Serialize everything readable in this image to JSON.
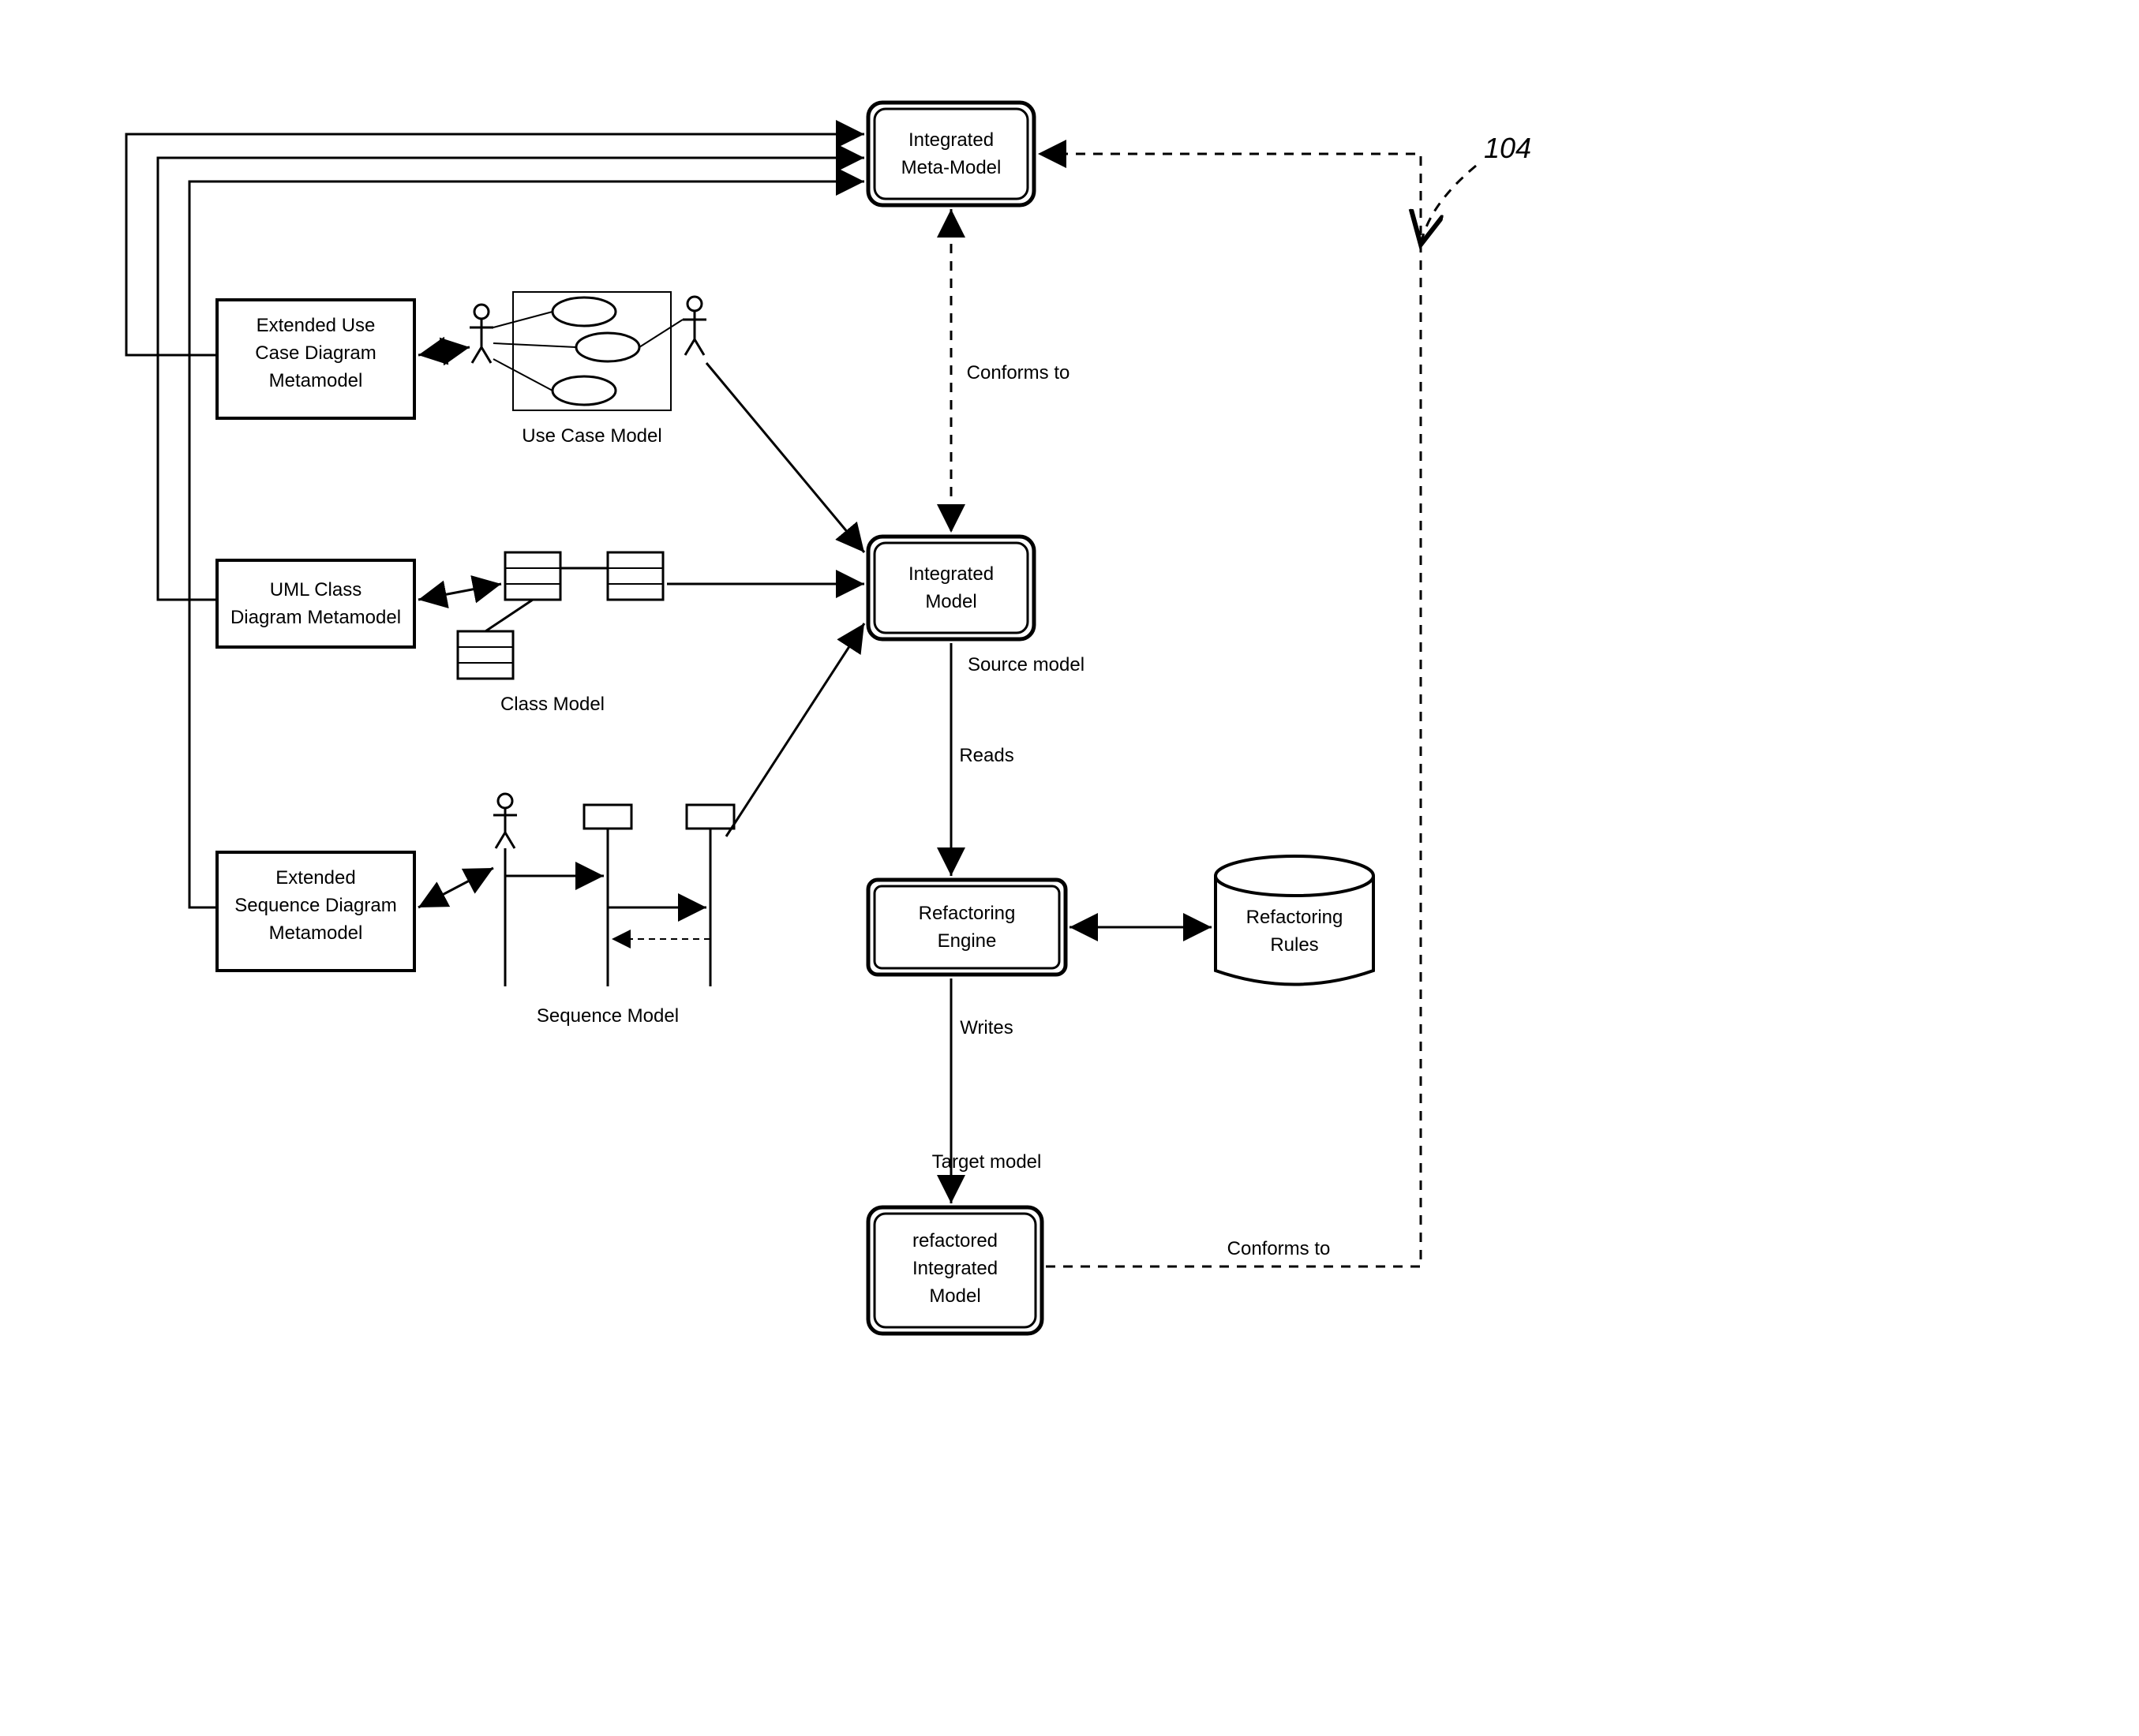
{
  "ref_number": "104",
  "boxes": {
    "integrated_meta_model": {
      "line1": "Integrated",
      "line2": "Meta-Model"
    },
    "extended_usecase": {
      "line1": "Extended Use",
      "line2": "Case Diagram",
      "line3": "Metamodel"
    },
    "uml_class": {
      "line1": "UML Class",
      "line2": "Diagram Metamodel"
    },
    "extended_sequence": {
      "line1": "Extended",
      "line2": "Sequence Diagram",
      "line3": "Metamodel"
    },
    "integrated_model": {
      "line1": "Integrated",
      "line2": "Model"
    },
    "refactoring_engine": {
      "line1": "Refactoring",
      "line2": "Engine"
    },
    "refactored_model": {
      "line1": "refactored",
      "line2": "Integrated",
      "line3": "Model"
    },
    "refactoring_rules": {
      "line1": "Refactoring",
      "line2": "Rules"
    }
  },
  "labels": {
    "usecase_model": "Use Case Model",
    "class_model": "Class Model",
    "sequence_model": "Sequence Model",
    "conforms_to_1": "Conforms to",
    "conforms_to_2": "Conforms to",
    "source_model": "Source model",
    "reads": "Reads",
    "writes": "Writes",
    "target_model": "Target model"
  }
}
